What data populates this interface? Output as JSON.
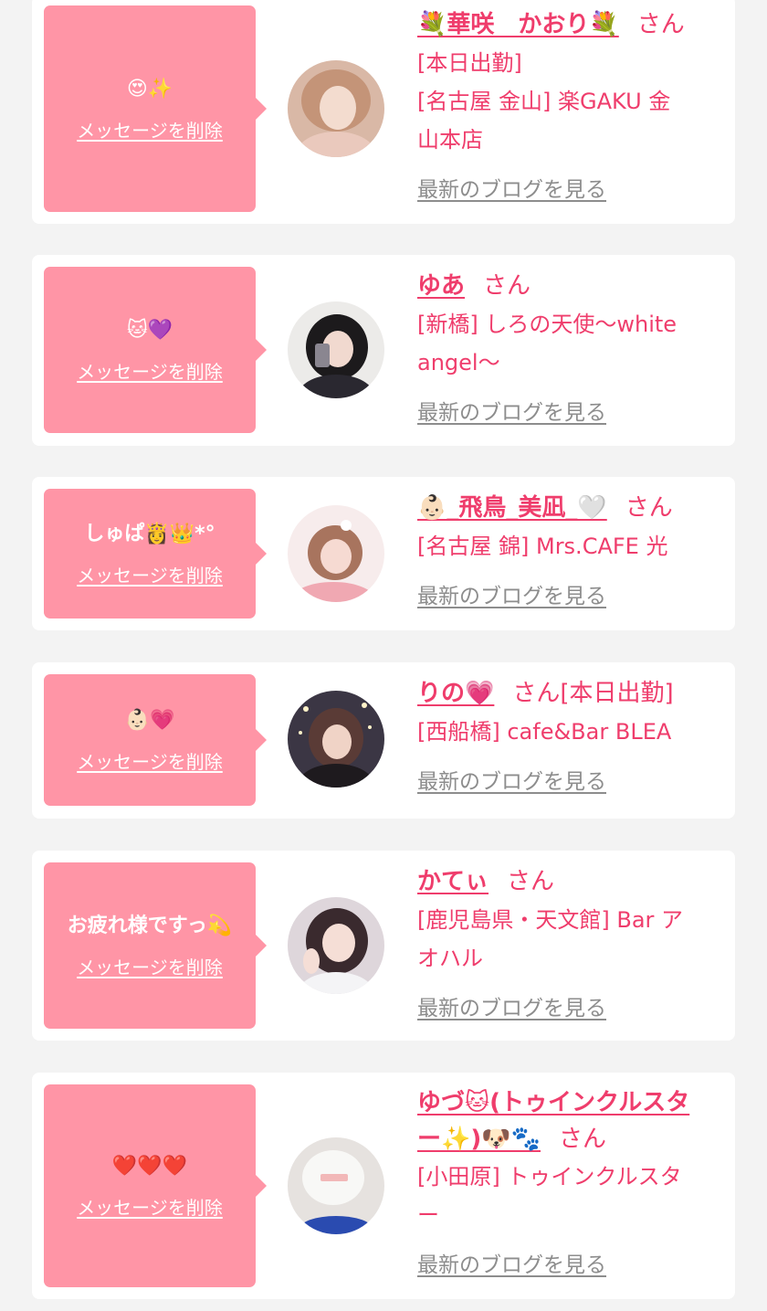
{
  "delete_label": "メッセージを削除",
  "blog_label": "最新のブログを見る",
  "honorific": "さん",
  "cards": [
    {
      "message": "😍✨",
      "name": "💐華咲　かおり💐",
      "lines": [
        "[本日出勤]",
        "[名古屋 金山] 楽GAKU 金",
        "山本店"
      ]
    },
    {
      "message": "🐱💜",
      "name": "ゆあ",
      "lines": [
        "[新橋] しろの天使〜white",
        "angel〜"
      ]
    },
    {
      "message": "しゅぱ👸👑*°",
      "name": "👶🏻_飛鳥_美凪_🤍",
      "lines": [
        "[名古屋 錦] Mrs.CAFE 光"
      ]
    },
    {
      "message": "👶🏻💗",
      "name": "りの💗",
      "suffix": "[本日出勤]",
      "lines": [
        "[西船橋] cafe&Bar BLEA"
      ]
    },
    {
      "message": "お疲れ様ですっ💫",
      "name": "かてぃ",
      "lines": [
        "[鹿児島県・天文館] Bar ア",
        "オハル"
      ]
    },
    {
      "message": "❤️❤️❤️",
      "name_line1": "ゆづ🐱(トゥインクルスタ",
      "name_line2": "ー✨)🐶🐾",
      "lines": [
        "[小田原] トゥインクルスタ",
        "ー"
      ]
    }
  ],
  "colors": {
    "accent": "#ef3d6c",
    "bubble": "#ff95a6",
    "link_gray": "#8d8d8d",
    "background": "#f3f3f3"
  }
}
